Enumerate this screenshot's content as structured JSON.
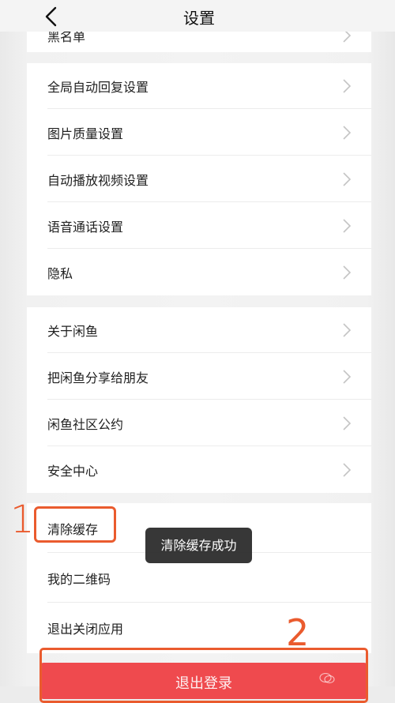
{
  "header": {
    "title": "设置"
  },
  "peek_row": {
    "label": "黑名单"
  },
  "groups": [
    {
      "items": [
        {
          "label": "全局自动回复设置"
        },
        {
          "label": "图片质量设置"
        },
        {
          "label": "自动播放视频设置"
        },
        {
          "label": "语音通话设置"
        },
        {
          "label": "隐私"
        }
      ]
    },
    {
      "items": [
        {
          "label": "关于闲鱼"
        },
        {
          "label": "把闲鱼分享给朋友"
        },
        {
          "label": "闲鱼社区公约"
        },
        {
          "label": "安全中心"
        }
      ]
    },
    {
      "items": [
        {
          "label": "清除缓存"
        },
        {
          "label": "我的二维码"
        },
        {
          "label": "退出关闭应用"
        }
      ]
    }
  ],
  "annotations": {
    "step1": "1",
    "step2": "2"
  },
  "toast": {
    "text": "清除缓存成功"
  },
  "logout_button": {
    "label": "退出登录"
  },
  "watermark": {
    "text": ""
  },
  "colors": {
    "accent_red": "#ef4a4e",
    "annotation_orange": "#ea5b2e"
  }
}
